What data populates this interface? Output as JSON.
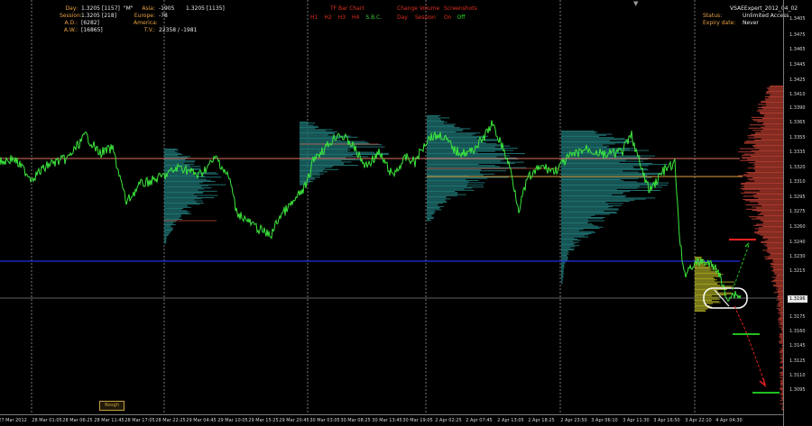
{
  "stats": {
    "day_label": "Day:",
    "day_value": "1.3205 [1157]",
    "day_tag": "\"M\"",
    "session_label": "Session:",
    "session_value": "1.3205 [218]",
    "ad_label": "A.D.:",
    "ad_value": "[6282]",
    "aw_label": "A.W.:",
    "aw_value": "[16865]"
  },
  "markets": {
    "asia_label": "Asia:",
    "asia_value": "-1905",
    "asia_price": "1.3205 [1135]",
    "europe_label": "Europe:",
    "europe_value": "-78",
    "america_label": "America:",
    "tv_label": "T.V.:",
    "tv_value": "22358 / -1981"
  },
  "toolbar": {
    "tf_title": "TF Bar Chart",
    "tf_buttons": [
      "H1",
      "H2",
      "H3",
      "H4",
      "S.B.C."
    ],
    "volume_title": "Change Volume",
    "volume_buttons": [
      "Day",
      "Session"
    ],
    "screenshots_title": "Screenshots",
    "screenshot_buttons": [
      "On",
      "Off"
    ]
  },
  "license": {
    "product": "VSAEExpert_2012_04_02",
    "status_label": "Status:",
    "status_value": "Unlimited Access",
    "expiry_label": "Expiry date:",
    "expiry_value": "Never"
  },
  "symbol_box": "Rough",
  "current_price": "1.3196",
  "y_axis": [
    "1.3405",
    "1.3475",
    "1.3465",
    "1.3445",
    "1.3425",
    "1.3410",
    "1.3390",
    "1.3365",
    "1.3355",
    "1.3335",
    "1.3320",
    "1.3310",
    "1.3295",
    "1.3275",
    "1.3260",
    "1.3240",
    "1.3230",
    "1.3215",
    "1.3185",
    "1.3175",
    "1.3160",
    "1.3145",
    "1.3125",
    "1.3110",
    "1.3095"
  ],
  "x_axis": [
    "27 Mar 2012",
    "28 Mar 01:05",
    "28 Mar 06:25",
    "28 Mar 11:45",
    "28 Mar 17:05",
    "28 Mar 22:25",
    "29 Mar 04:45",
    "29 Mar 10:05",
    "29 Mar 15:25",
    "29 Mar 20:45",
    "30 Mar 03:05",
    "30 Mar 08:25",
    "30 Mar 13:45",
    "30 Mar 19:05",
    "2 Apr 02:25",
    "2 Apr 07:45",
    "2 Apr 13:05",
    "2 Apr 18:25",
    "2 Apr 23:50",
    "3 Apr 06:10",
    "3 Apr 11:30",
    "3 Apr 16:50",
    "3 Apr 22:10",
    "4 Apr 04:30"
  ],
  "colors": {
    "price_line": "#3ce83c",
    "profile_teal": "#1e6e6e",
    "profile_red": "#a8382c",
    "profile_yellow": "#9a9a20",
    "level_salmon": "#e07060",
    "level_blue": "#2030e0",
    "level_orange": "#e0a040",
    "grid": "#c8c8c8"
  }
}
